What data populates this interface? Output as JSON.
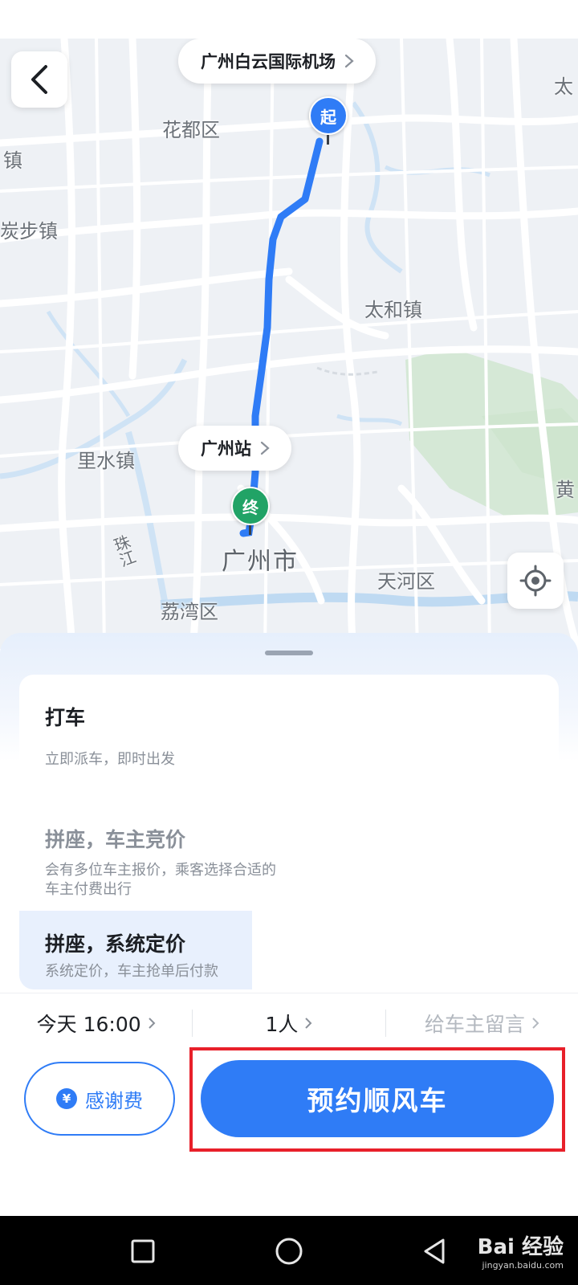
{
  "map": {
    "origin": "广州白云国际机场",
    "destination": "广州站",
    "start_marker": "起",
    "end_marker": "终",
    "labels": [
      "花都区",
      "镇",
      "炭步镇",
      "太",
      "太和镇",
      "里水镇",
      "黄",
      "广州市",
      "珠江",
      "天河区",
      "荔湾区"
    ],
    "route_color": "#2f7cf6",
    "start_color": "#2f7cf6",
    "end_color": "#21a366"
  },
  "ride_options": [
    {
      "title": "打车",
      "desc": "立即派车，即时出发"
    },
    {
      "title": "拼座，车主竞价",
      "desc": "会有多位车主报价，乘客选择合适的车主付费出行"
    },
    {
      "title": "拼座，系统定价",
      "desc": "系统定价，车主抢单后付款"
    }
  ],
  "booking": {
    "time": "今天 16:00",
    "passengers": "1人",
    "message_placeholder": "给车主留言",
    "thanks_fee": "感谢费",
    "yen_symbol": "¥",
    "book_button": "预约顺风车"
  },
  "watermark": {
    "text": "Bai 经验",
    "url": "jingyan.baidu.com"
  },
  "colors": {
    "accent": "#2f7cf6",
    "highlight": "#e8202a"
  }
}
